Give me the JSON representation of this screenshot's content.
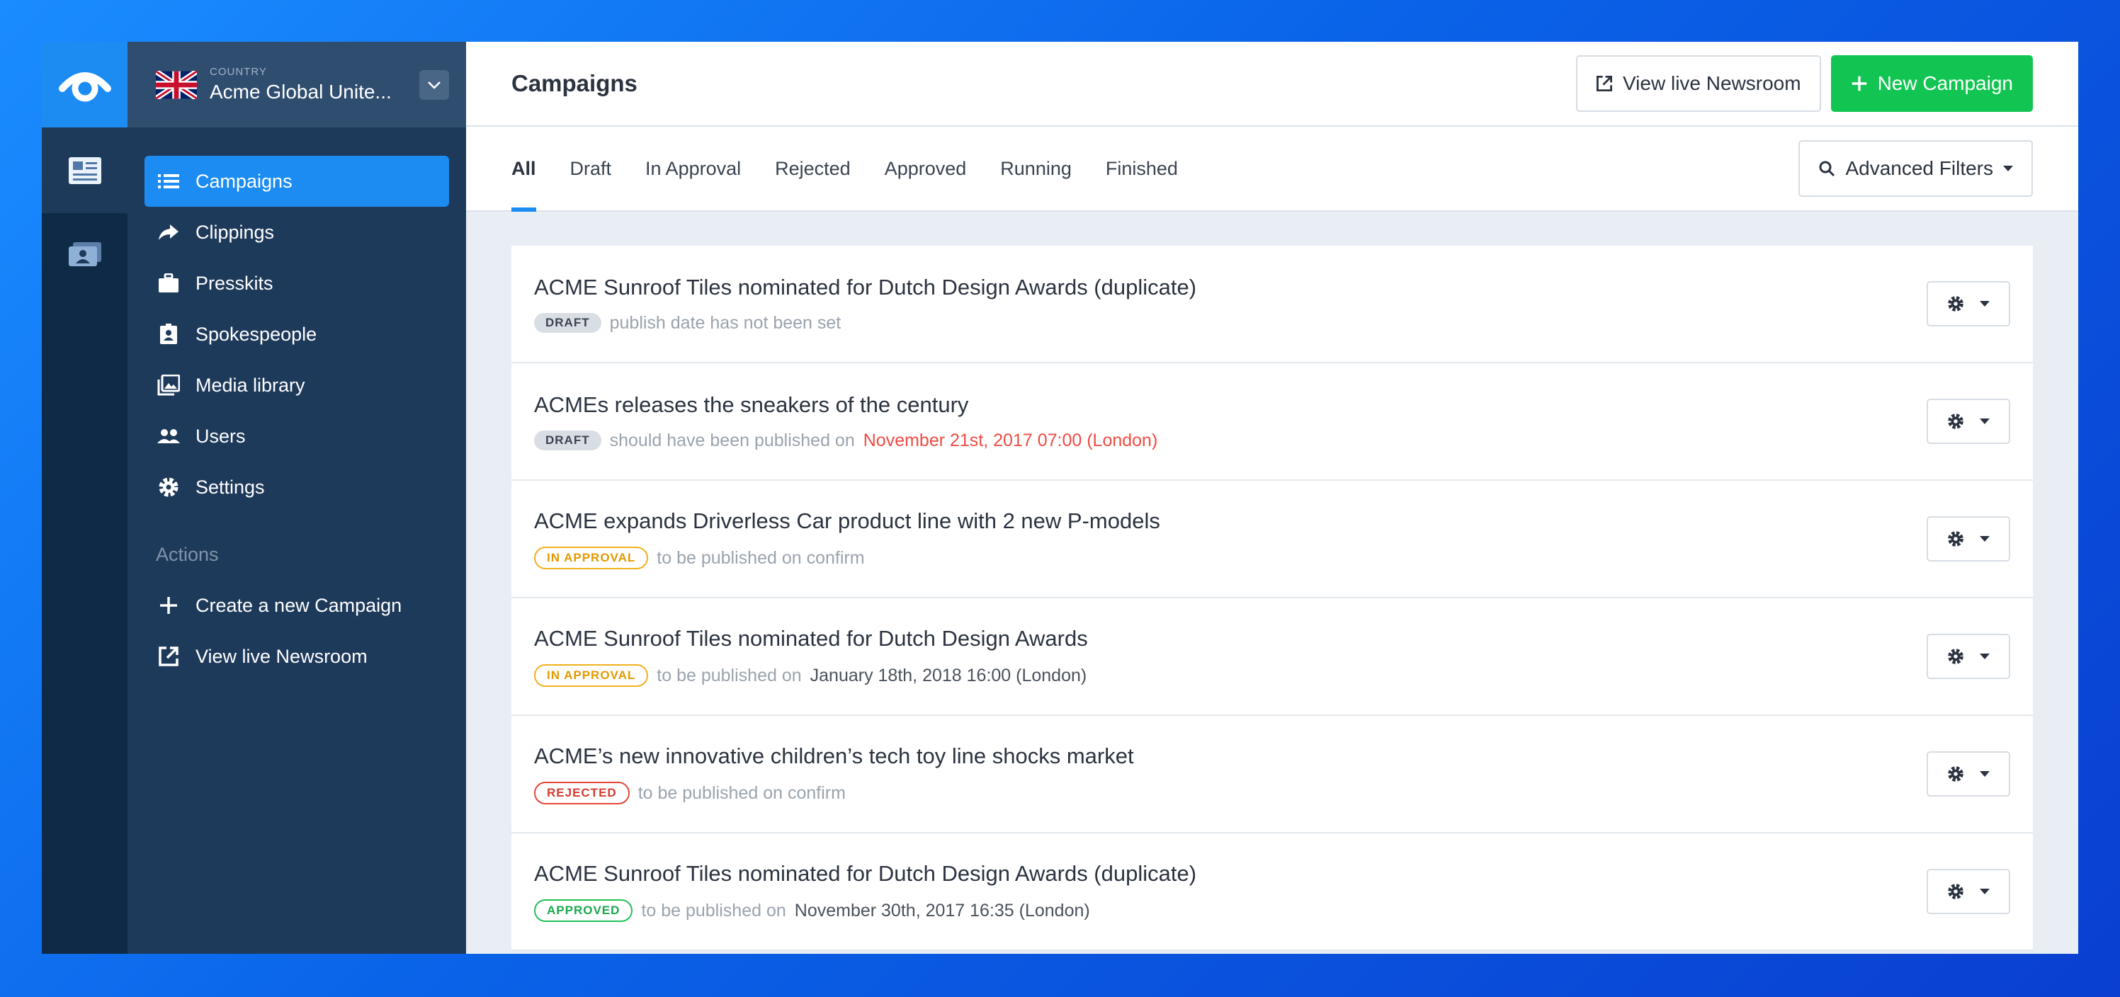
{
  "colors": {
    "accent": "#1c8cf3",
    "success": "#12c552",
    "sidebar": "#1e3a5a",
    "rail": "#0e2a47",
    "danger": "#ef4c44",
    "warning": "#f2b01e"
  },
  "country": {
    "caption": "COUNTRY",
    "name": "Acme Global Unite...",
    "flag_icon": "uk-flag-icon"
  },
  "sidebar": {
    "items": [
      {
        "label": "Campaigns",
        "icon": "list-icon",
        "active": true
      },
      {
        "label": "Clippings",
        "icon": "share-arrow-icon"
      },
      {
        "label": "Presskits",
        "icon": "briefcase-icon"
      },
      {
        "label": "Spokespeople",
        "icon": "badge-icon"
      },
      {
        "label": "Media library",
        "icon": "images-icon"
      },
      {
        "label": "Users",
        "icon": "users-icon"
      },
      {
        "label": "Settings",
        "icon": "gear-icon"
      }
    ],
    "actions_title": "Actions",
    "actions": [
      {
        "label": "Create a new Campaign",
        "icon": "plus-icon"
      },
      {
        "label": "View live Newsroom",
        "icon": "external-link-icon"
      }
    ]
  },
  "header": {
    "title": "Campaigns",
    "view_live_label": "View live Newsroom",
    "new_campaign_label": "New Campaign"
  },
  "tabs": {
    "items": [
      "All",
      "Draft",
      "In Approval",
      "Rejected",
      "Approved",
      "Running",
      "Finished"
    ],
    "active": "All",
    "filters_label": "Advanced Filters"
  },
  "campaigns": [
    {
      "title": "ACME Sunroof Tiles nominated for Dutch Design Awards (duplicate)",
      "status": "DRAFT",
      "meta": "publish date has not been set",
      "date": ""
    },
    {
      "title": "ACMEs releases the sneakers of the century",
      "status": "DRAFT",
      "meta": "should have been published on",
      "date": "November 21st, 2017 07:00 (London)"
    },
    {
      "title": "ACME expands Driverless Car product line with 2 new P-models",
      "status": "IN APPROVAL",
      "meta": "to be published on confirm",
      "date": ""
    },
    {
      "title": "ACME Sunroof Tiles nominated for Dutch Design Awards",
      "status": "IN APPROVAL",
      "meta": "to be published on",
      "date": "January 18th, 2018 16:00 (London)"
    },
    {
      "title": "ACME’s new innovative children’s tech toy line shocks market",
      "status": "REJECTED",
      "meta": "to be published on confirm",
      "date": ""
    },
    {
      "title": "ACME Sunroof Tiles nominated for Dutch Design Awards (duplicate)",
      "status": "APPROVED",
      "meta": "to be published on",
      "date": "November 30th, 2017 16:35 (London)"
    }
  ]
}
